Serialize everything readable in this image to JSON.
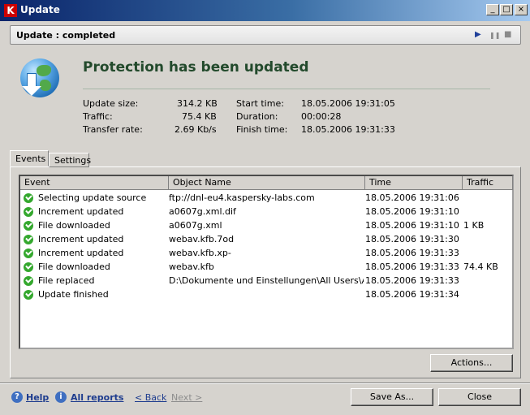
{
  "window": {
    "title": "Update",
    "app_icon": "kaspersky-k-icon",
    "btn_min": "_",
    "btn_max": "□",
    "btn_close": "×"
  },
  "status_panel": {
    "title": "Update : completed",
    "play": "▶",
    "pause": "❚❚",
    "stop": "■"
  },
  "headline": "Protection has been updated",
  "stats": {
    "update_size_label": "Update size:",
    "update_size_value": "314.2 KB",
    "traffic_label": "Traffic:",
    "traffic_value": "75.4 KB",
    "transfer_rate_label": "Transfer rate:",
    "transfer_rate_value": "2.69 Kb/s",
    "start_time_label": "Start time:",
    "start_time_value": "18.05.2006 19:31:05",
    "duration_label": "Duration:",
    "duration_value": "00:00:28",
    "finish_time_label": "Finish time:",
    "finish_time_value": "18.05.2006 19:31:33"
  },
  "tabs": [
    {
      "label": "Events",
      "active": true
    },
    {
      "label": "Settings",
      "active": false
    }
  ],
  "columns": [
    "Event",
    "Object Name",
    "Time",
    "Traffic"
  ],
  "rows": [
    {
      "event": "Selecting update source",
      "object": "ftp://dnl-eu4.kaspersky-labs.com",
      "time": "18.05.2006 19:31:06",
      "traffic": ""
    },
    {
      "event": "Increment updated",
      "object": "a0607g.xml.dif",
      "time": "18.05.2006 19:31:10",
      "traffic": ""
    },
    {
      "event": "File downloaded",
      "object": "a0607g.xml",
      "time": "18.05.2006 19:31:10",
      "traffic": "1 KB"
    },
    {
      "event": "Increment updated",
      "object": "webav.kfb.7od",
      "time": "18.05.2006 19:31:30",
      "traffic": ""
    },
    {
      "event": "Increment updated",
      "object": "webav.kfb.xp-",
      "time": "18.05.2006 19:31:33",
      "traffic": ""
    },
    {
      "event": "File downloaded",
      "object": "webav.kfb",
      "time": "18.05.2006 19:31:33",
      "traffic": "74.4 KB"
    },
    {
      "event": "File replaced",
      "object": "D:\\Dokumente und Einstellungen\\All Users\\Anw...",
      "time": "18.05.2006 19:31:33",
      "traffic": ""
    },
    {
      "event": "Update finished",
      "object": "",
      "time": "18.05.2006 19:31:34",
      "traffic": ""
    }
  ],
  "buttons": {
    "actions": "Actions...",
    "save_as": "Save As...",
    "close": "Close"
  },
  "footer": {
    "help": "Help",
    "help_icon": "?",
    "all_reports": "All reports",
    "info_icon": "i",
    "back": "< Back",
    "next": "Next >"
  }
}
